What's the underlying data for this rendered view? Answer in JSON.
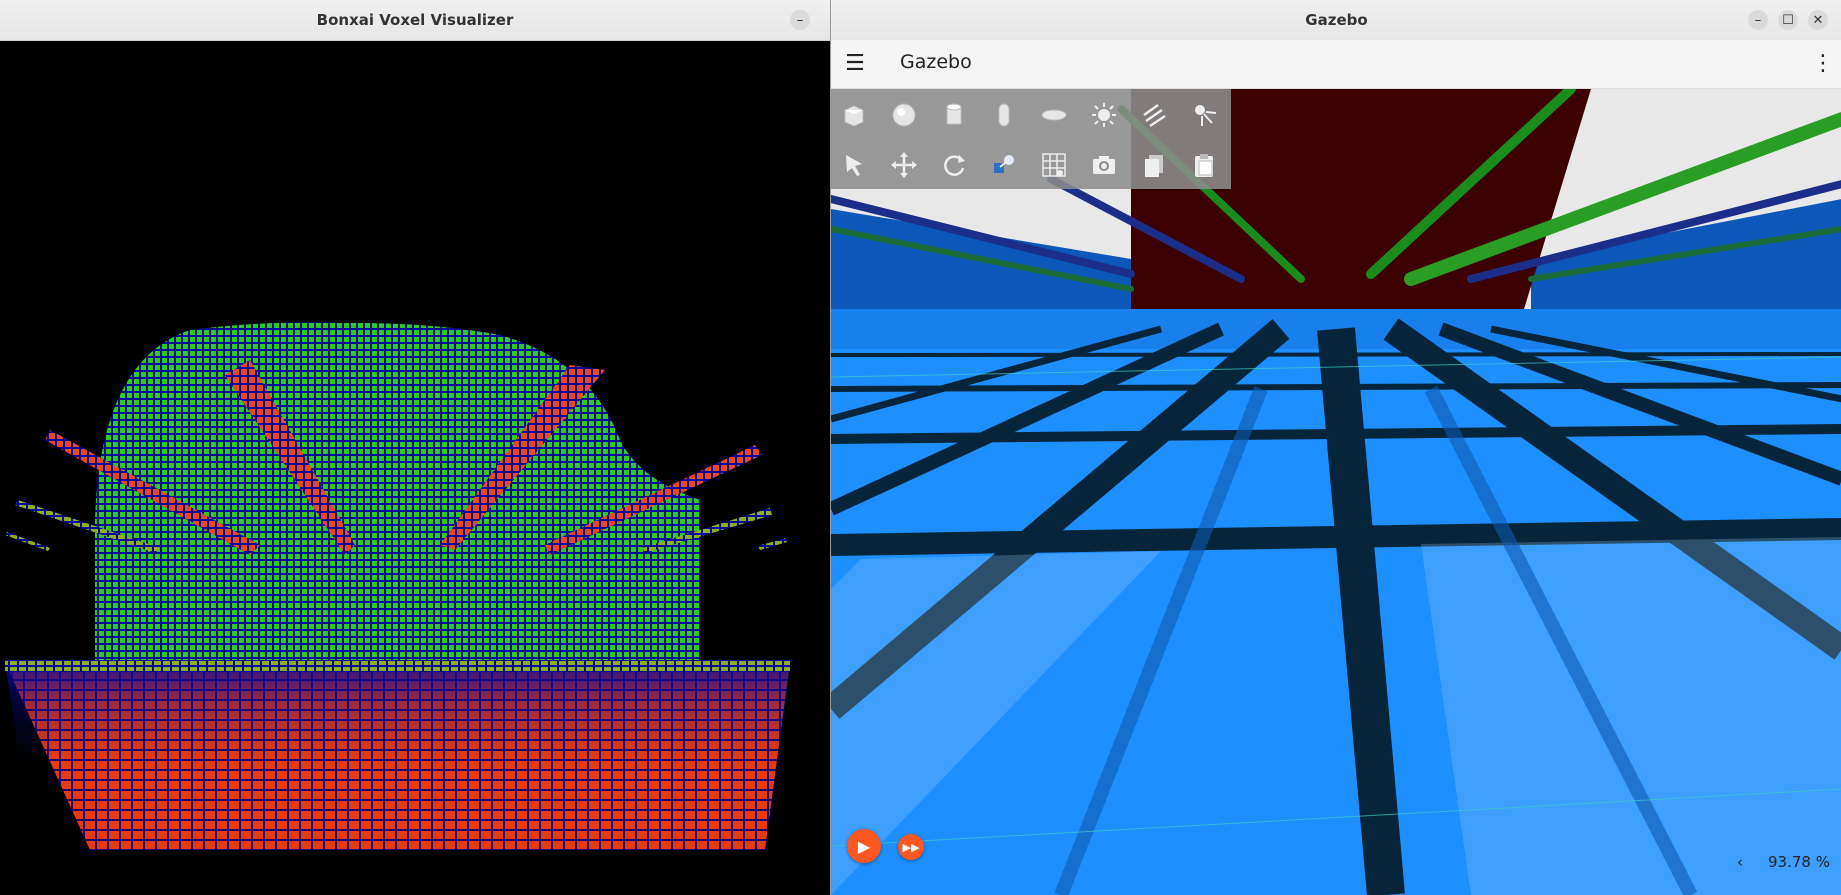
{
  "bonxai_window": {
    "title": "Bonxai Voxel Visualizer",
    "colors": {
      "background": "#000000",
      "foliage": "#2ecc1a",
      "beams": "#e8491c",
      "floor": "#e83a10",
      "edges": "#0a0a9a"
    }
  },
  "gazebo_window": {
    "title": "Gazebo",
    "app_title": "Gazebo",
    "window_controls": {
      "minimize": "–",
      "maximize": "☐",
      "close": "✕"
    },
    "toolbar_row1": [
      {
        "name": "box-shape-icon"
      },
      {
        "name": "sphere-shape-icon"
      },
      {
        "name": "cylinder-shape-icon"
      },
      {
        "name": "capsule-shape-icon"
      },
      {
        "name": "ellipsoid-shape-icon"
      },
      {
        "name": "sun-light-icon"
      },
      {
        "name": "directional-light-icon"
      },
      {
        "name": "spot-light-icon"
      }
    ],
    "toolbar_row2": [
      {
        "name": "select-arrow-icon"
      },
      {
        "name": "translate-icon"
      },
      {
        "name": "rotate-icon"
      },
      {
        "name": "view-angle-icon"
      },
      {
        "name": "grid-snap-icon"
      },
      {
        "name": "screenshot-camera-icon"
      },
      {
        "name": "copy-icon"
      },
      {
        "name": "paste-icon"
      }
    ],
    "playback": {
      "play_icon": "▶",
      "step_icon": "▶▶"
    },
    "real_time_factor": "93.78 %",
    "rtf_chevron": "‹",
    "colors": {
      "accent": "#ff5722",
      "ground": "#1e8fff",
      "grid_lines": "#0a2a3a",
      "wall": "#3d0000"
    }
  }
}
